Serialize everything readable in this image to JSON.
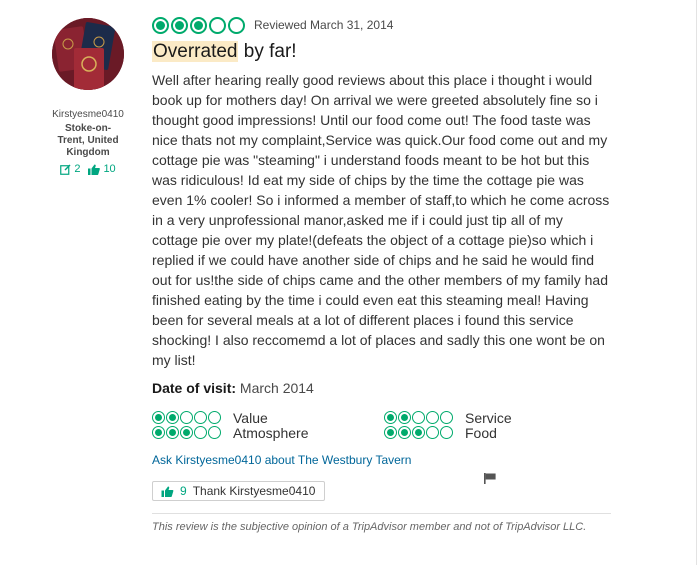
{
  "reviewer": {
    "name": "Kirstyesme0410",
    "location": "Stoke-on-Trent, United Kingdom",
    "review_count": "2",
    "helpful_votes": "10",
    "avatar_icon": "passport-photo"
  },
  "review": {
    "rating": 3,
    "rating_max": 5,
    "reviewed_date": "Reviewed March 31, 2014",
    "title_highlight": "Overrated",
    "title_rest": " by far!",
    "body": "Well after hearing really good reviews about this place i thought i would book up for mothers day! On arrival we were greeted absolutely fine so i thought good impressions! Until our food come out! The food taste was nice thats not my complaint,Service was quick.Our food come out and my cottage pie was \"steaming\" i understand foods meant to be hot but this was ridiculous! Id eat my side of chips by the time the cottage pie was even 1% cooler! So i informed a member of staff,to which he come across in a very unprofessional manor,asked me if i could just tip all of my cottage pie over my plate!(defeats the object of a cottage pie)so which i replied if we could have another side of chips and he said he would find out for us!the side of chips came and the other members of my family had finished eating by the time i could even eat this steaming meal! Having been for several meals at a lot of different places i found this service shocking! I also reccomemd a lot of places and sadly this one wont be on my list!",
    "visit_label": "Date of visit:",
    "visit_value": " March 2014",
    "sub_ratings": [
      {
        "label": "Value",
        "rating": 2
      },
      {
        "label": "Service",
        "rating": 2
      },
      {
        "label": "Atmosphere",
        "rating": 3
      },
      {
        "label": "Food",
        "rating": 3
      }
    ],
    "ask_link": "Ask Kirstyesme0410 about The Westbury Tavern",
    "thank_count": "9",
    "thank_label": "Thank Kirstyesme0410",
    "disclaimer": "This review is the subjective opinion of a TripAdvisor member and not of TripAdvisor LLC."
  },
  "colors": {
    "brand_green": "#00aa6c",
    "link_blue": "#006699",
    "highlight": "#fbeac6"
  }
}
